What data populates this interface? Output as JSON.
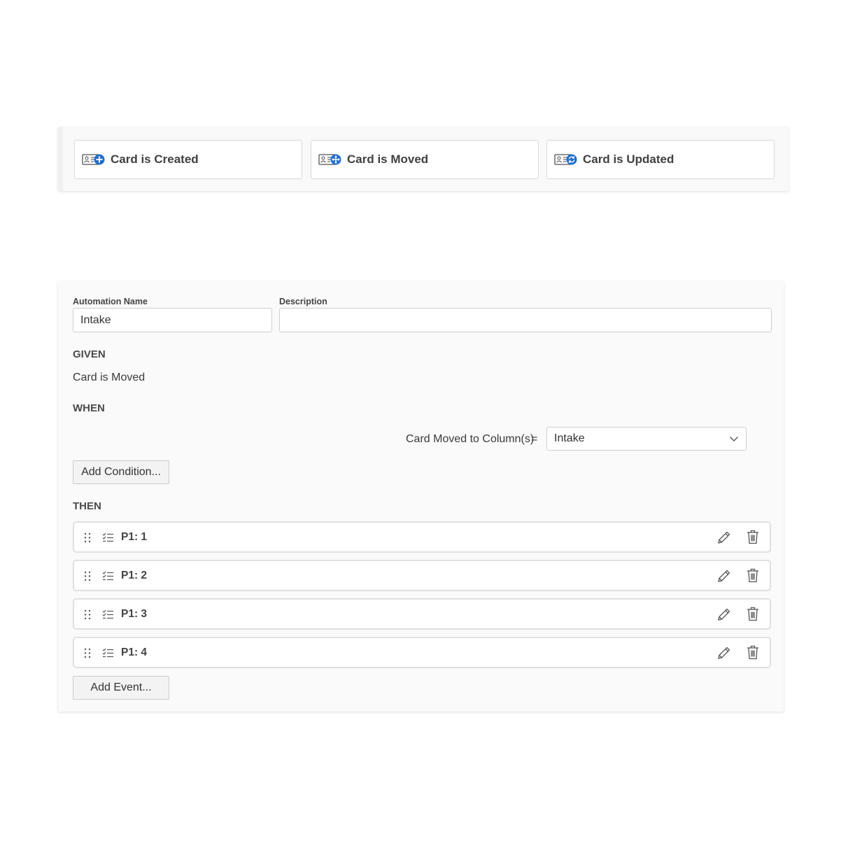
{
  "triggers": [
    {
      "label": "Card is Created",
      "icon": "card-plus-icon"
    },
    {
      "label": "Card is Moved",
      "icon": "card-move-icon"
    },
    {
      "label": "Card is Updated",
      "icon": "card-refresh-icon"
    }
  ],
  "form": {
    "name_label": "Automation Name",
    "name_value": "Intake",
    "description_label": "Description",
    "description_value": "",
    "given_heading": "GIVEN",
    "given_value": "Card is Moved",
    "when_heading": "WHEN",
    "condition_label": "Card Moved to Column(s)",
    "condition_operator": "=",
    "condition_value": "Intake",
    "add_condition_label": "Add Condition...",
    "then_heading": "THEN",
    "events": [
      {
        "label": "P1: 1"
      },
      {
        "label": "P1: 2"
      },
      {
        "label": "P1: 3"
      },
      {
        "label": "P1: 4"
      }
    ],
    "add_event_label": "Add Event..."
  },
  "colors": {
    "accent": "#1f6fd1",
    "icon_gray": "#555555"
  }
}
